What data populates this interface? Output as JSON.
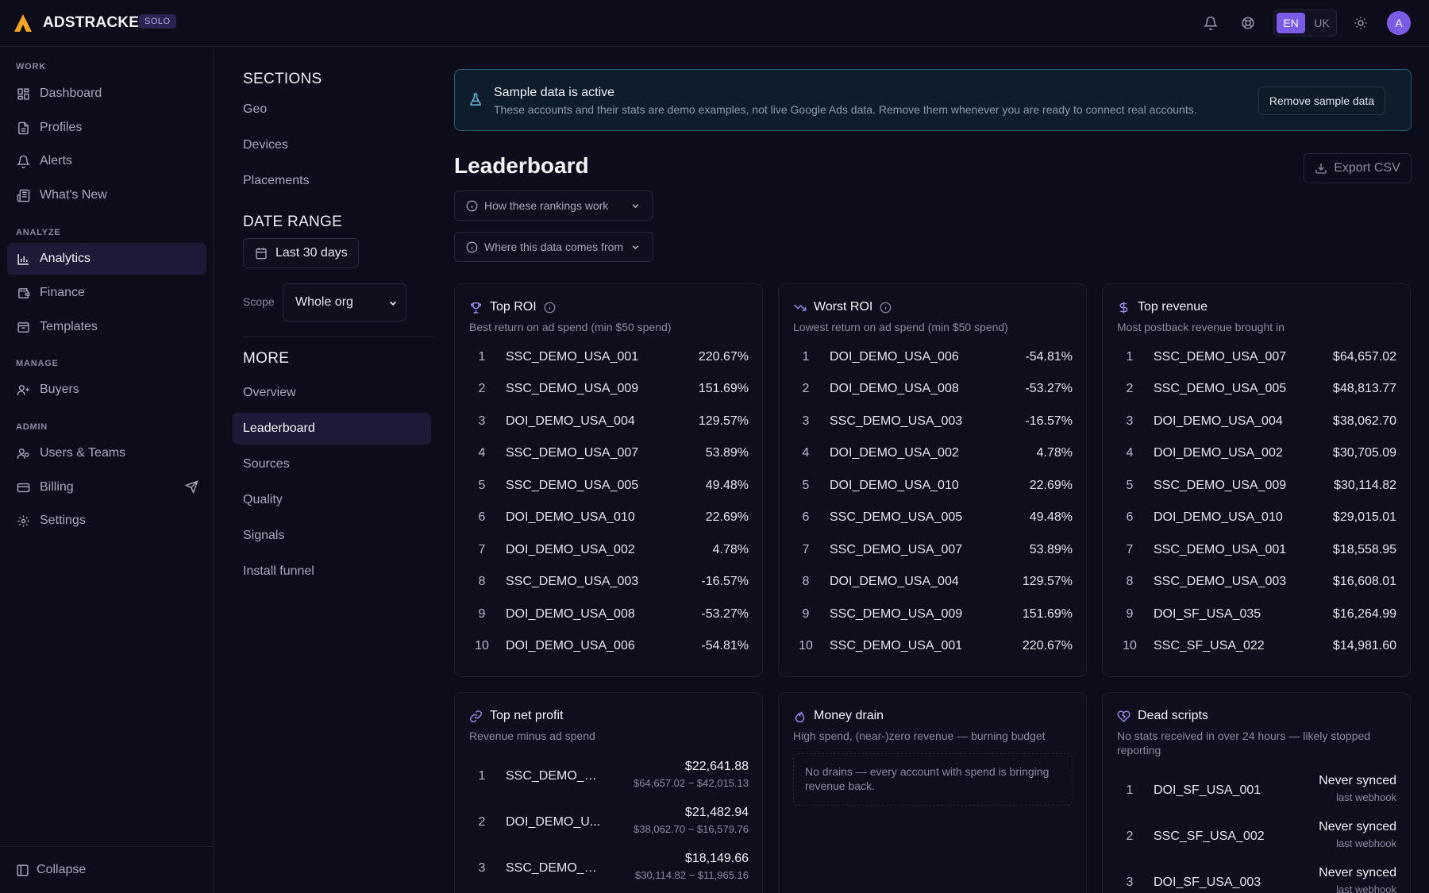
{
  "app": {
    "brand": "ADSTRACKER",
    "plan_badge": "SOLO"
  },
  "topbar": {
    "lang_active": "EN",
    "lang_other": "UK",
    "avatar_initial": "A"
  },
  "sidebar": {
    "groups": {
      "work": "WORK",
      "analyze": "ANALYZE",
      "manage": "MANAGE",
      "admin": "ADMIN"
    },
    "items": {
      "dashboard": "Dashboard",
      "profiles": "Profiles",
      "alerts": "Alerts",
      "whats_new": "What's New",
      "analytics": "Analytics",
      "finance": "Finance",
      "templates": "Templates",
      "buyers": "Buyers",
      "users_teams": "Users & Teams",
      "billing": "Billing",
      "settings": "Settings"
    },
    "collapse": "Collapse"
  },
  "sections": {
    "title": "SECTIONS",
    "items": [
      "Geo",
      "Devices",
      "Placements"
    ],
    "date_range_title": "DATE RANGE",
    "date_range_value": "Last 30 days",
    "scope_label": "Scope",
    "scope_value": "Whole org",
    "more_title": "MORE",
    "more_items": [
      "Overview",
      "Leaderboard",
      "Sources",
      "Quality",
      "Signals",
      "Install funnel"
    ]
  },
  "banner": {
    "title": "Sample data is active",
    "text": "These accounts and their stats are demo examples, not live Google Ads data. Remove them whenever you are ready to connect real accounts.",
    "button": "Remove sample data"
  },
  "page": {
    "title": "Leaderboard",
    "export": "Export CSV",
    "accordion1": "How these rankings work",
    "accordion2": "Where this data comes from"
  },
  "top_roi": {
    "title": "Top ROI",
    "subtitle": "Best return on ad spend (min $50 spend)",
    "rows": [
      {
        "rank": "1",
        "name": "SSC_DEMO_USA_001",
        "value": "220.67%"
      },
      {
        "rank": "2",
        "name": "SSC_DEMO_USA_009",
        "value": "151.69%"
      },
      {
        "rank": "3",
        "name": "DOI_DEMO_USA_004",
        "value": "129.57%"
      },
      {
        "rank": "4",
        "name": "SSC_DEMO_USA_007",
        "value": "53.89%"
      },
      {
        "rank": "5",
        "name": "SSC_DEMO_USA_005",
        "value": "49.48%"
      },
      {
        "rank": "6",
        "name": "DOI_DEMO_USA_010",
        "value": "22.69%"
      },
      {
        "rank": "7",
        "name": "DOI_DEMO_USA_002",
        "value": "4.78%"
      },
      {
        "rank": "8",
        "name": "SSC_DEMO_USA_003",
        "value": "-16.57%"
      },
      {
        "rank": "9",
        "name": "DOI_DEMO_USA_008",
        "value": "-53.27%"
      },
      {
        "rank": "10",
        "name": "DOI_DEMO_USA_006",
        "value": "-54.81%"
      }
    ]
  },
  "worst_roi": {
    "title": "Worst ROI",
    "subtitle": "Lowest return on ad spend (min $50 spend)",
    "rows": [
      {
        "rank": "1",
        "name": "DOI_DEMO_USA_006",
        "value": "-54.81%"
      },
      {
        "rank": "2",
        "name": "DOI_DEMO_USA_008",
        "value": "-53.27%"
      },
      {
        "rank": "3",
        "name": "SSC_DEMO_USA_003",
        "value": "-16.57%"
      },
      {
        "rank": "4",
        "name": "DOI_DEMO_USA_002",
        "value": "4.78%"
      },
      {
        "rank": "5",
        "name": "DOI_DEMO_USA_010",
        "value": "22.69%"
      },
      {
        "rank": "6",
        "name": "SSC_DEMO_USA_005",
        "value": "49.48%"
      },
      {
        "rank": "7",
        "name": "SSC_DEMO_USA_007",
        "value": "53.89%"
      },
      {
        "rank": "8",
        "name": "DOI_DEMO_USA_004",
        "value": "129.57%"
      },
      {
        "rank": "9",
        "name": "SSC_DEMO_USA_009",
        "value": "151.69%"
      },
      {
        "rank": "10",
        "name": "SSC_DEMO_USA_001",
        "value": "220.67%"
      }
    ]
  },
  "top_revenue": {
    "title": "Top revenue",
    "subtitle": "Most postback revenue brought in",
    "rows": [
      {
        "rank": "1",
        "name": "SSC_DEMO_USA_007",
        "value": "$64,657.02"
      },
      {
        "rank": "2",
        "name": "SSC_DEMO_USA_005",
        "value": "$48,813.77"
      },
      {
        "rank": "3",
        "name": "DOI_DEMO_USA_004",
        "value": "$38,062.70"
      },
      {
        "rank": "4",
        "name": "DOI_DEMO_USA_002",
        "value": "$30,705.09"
      },
      {
        "rank": "5",
        "name": "SSC_DEMO_USA_009",
        "value": "$30,114.82"
      },
      {
        "rank": "6",
        "name": "DOI_DEMO_USA_010",
        "value": "$29,015.01"
      },
      {
        "rank": "7",
        "name": "SSC_DEMO_USA_001",
        "value": "$18,558.95"
      },
      {
        "rank": "8",
        "name": "SSC_DEMO_USA_003",
        "value": "$16,608.01"
      },
      {
        "rank": "9",
        "name": "DOI_SF_USA_035",
        "value": "$16,264.99"
      },
      {
        "rank": "10",
        "name": "SSC_SF_USA_022",
        "value": "$14,981.60"
      }
    ]
  },
  "top_net_profit": {
    "title": "Top net profit",
    "subtitle": "Revenue minus ad spend",
    "rows": [
      {
        "rank": "1",
        "name": "SSC_DEMO_U...",
        "value": "$22,641.88",
        "detail": "$64,657.02 − $42,015.13"
      },
      {
        "rank": "2",
        "name": "DOI_DEMO_U...",
        "value": "$21,482.94",
        "detail": "$38,062.70 − $16,579.76"
      },
      {
        "rank": "3",
        "name": "SSC_DEMO_U...",
        "value": "$18,149.66",
        "detail": "$30,114.82 − $11,965.16"
      }
    ]
  },
  "money_drain": {
    "title": "Money drain",
    "subtitle": "High spend, (near-)zero revenue — burning budget",
    "empty": "No drains — every account with spend is bringing revenue back."
  },
  "dead_scripts": {
    "title": "Dead scripts",
    "subtitle": "No stats received in over 24 hours — likely stopped reporting",
    "rows": [
      {
        "rank": "1",
        "name": "DOI_SF_USA_001",
        "value": "Never synced",
        "detail": "last webhook"
      },
      {
        "rank": "2",
        "name": "SSC_SF_USA_002",
        "value": "Never synced",
        "detail": "last webhook"
      },
      {
        "rank": "3",
        "name": "DOI_SF_USA_003",
        "value": "Never synced",
        "detail": "last webhook"
      }
    ]
  },
  "colors": {
    "accent": "#7c5ce6",
    "logo": "#f5a524",
    "background": "#0c0c1a"
  }
}
